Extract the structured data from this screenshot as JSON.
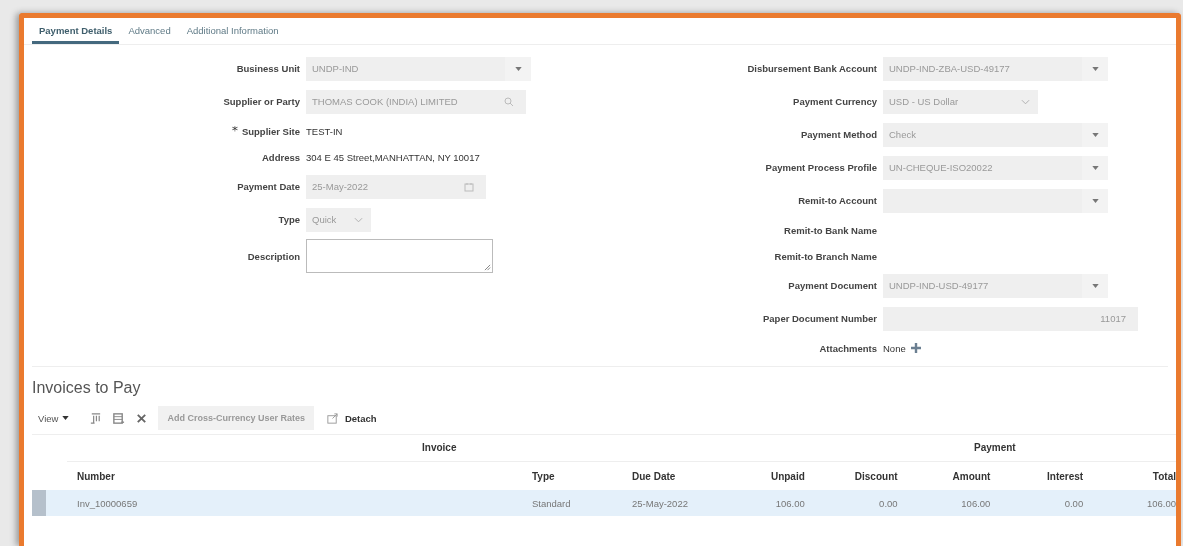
{
  "tabs": [
    {
      "label": "Payment Details",
      "selected": true
    },
    {
      "label": "Advanced",
      "selected": false
    },
    {
      "label": "Additional Information",
      "selected": false
    }
  ],
  "left_fields": [
    {
      "label": "Business Unit",
      "kind": "select",
      "value": "UNDP-IND",
      "required": false
    },
    {
      "label": "Supplier or Party",
      "kind": "search",
      "value": "THOMAS COOK (INDIA) LIMITED",
      "required": false
    },
    {
      "label": "Supplier Site",
      "kind": "static",
      "value": "TEST-IN",
      "required": true
    },
    {
      "label": "Address",
      "kind": "static",
      "value": "304 E 45 Street,MANHATTAN, NY 10017",
      "required": false
    },
    {
      "label": "Payment Date",
      "kind": "date",
      "value": "25-May-2022",
      "required": false
    },
    {
      "label": "Type",
      "kind": "choice",
      "value": "Quick",
      "required": false
    },
    {
      "label": "Description",
      "kind": "textarea",
      "required": false
    }
  ],
  "right_fields": [
    {
      "label": "Disbursement Bank Account",
      "kind": "select",
      "value": "UNDP-IND-ZBA-USD-49177"
    },
    {
      "label": "Payment Currency",
      "kind": "choice",
      "value": "USD - US Dollar"
    },
    {
      "label": "Payment Method",
      "kind": "select",
      "value": "Check"
    },
    {
      "label": "Payment Process Profile",
      "kind": "select",
      "value": "UN-CHEQUE-ISO20022"
    },
    {
      "label": "Remit-to Account",
      "kind": "select"
    },
    {
      "label": "Remit-to Bank Name",
      "kind": "static"
    },
    {
      "label": "Remit-to Branch Name",
      "kind": "static"
    },
    {
      "label": "Payment Document",
      "kind": "select",
      "value": "UNDP-IND-USD-49177"
    },
    {
      "label": "Paper Document Number",
      "kind": "number",
      "value": "11017"
    },
    {
      "label": "Attachments",
      "kind": "attach",
      "value": "None"
    }
  ],
  "invoices": {
    "title": "Invoices to Pay",
    "view_menu": "View",
    "add_rates_button": "Add Cross-Currency User Rates",
    "detach_button": "Detach",
    "group_headers": [
      "Invoice",
      "Payment"
    ],
    "columns": [
      "Number",
      "Type",
      "Due Date",
      "Unpaid",
      "Discount",
      "Amount",
      "Interest",
      "Total"
    ],
    "rows": [
      {
        "selected": true,
        "cells": [
          "Inv_10000659",
          "Standard",
          "25-May-2022",
          "106.00",
          "0.00",
          "106.00",
          "0.00",
          "106.00"
        ]
      }
    ]
  }
}
